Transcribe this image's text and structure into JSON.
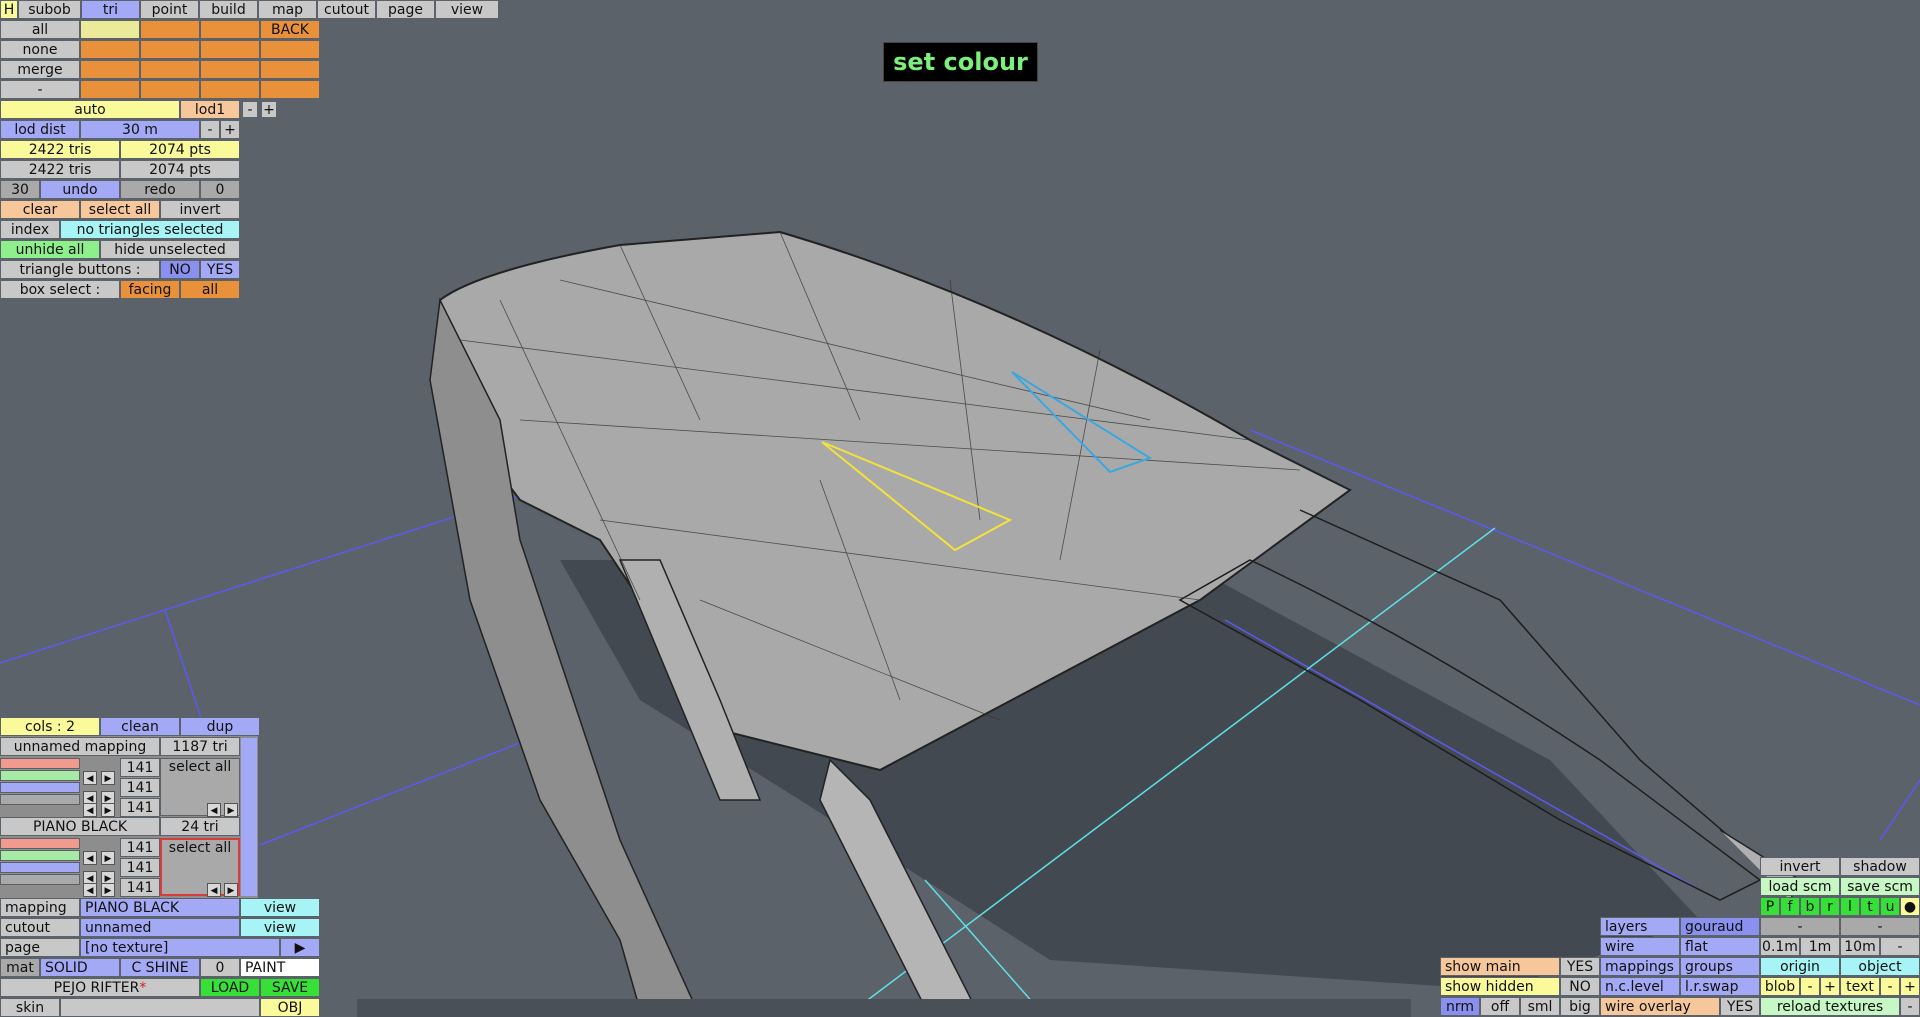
{
  "top_menu": {
    "h": "H",
    "items": [
      "subob",
      "tri",
      "point",
      "build",
      "map",
      "cutout",
      "page",
      "view"
    ]
  },
  "select_grid": {
    "rows": [
      "all",
      "none",
      "merge",
      "-"
    ],
    "back": "BACK"
  },
  "lod": {
    "auto": "auto",
    "lod1": "lod1",
    "minus": "-",
    "plus": "+",
    "dist_label": "lod dist",
    "dist_value": "30 m"
  },
  "stats": {
    "tris1": "2422 tris",
    "pts1": "2074 pts",
    "tris2": "2422 tris",
    "pts2": "2074 pts"
  },
  "undo_row": {
    "count": "30",
    "undo": "undo",
    "redo": "redo",
    "redo_count": "0"
  },
  "select_row": {
    "clear": "clear",
    "select_all": "select all",
    "invert": "invert"
  },
  "index_row": {
    "index": "index",
    "status": "no triangles selected"
  },
  "hide_row": {
    "unhide": "unhide all",
    "hide": "hide unselected"
  },
  "tri_buttons": {
    "label": "triangle buttons :",
    "no": "NO",
    "yes": "YES"
  },
  "box_select": {
    "label": "box select :",
    "facing": "facing",
    "all": "all"
  },
  "set_colour": "set colour",
  "mapping_panel": {
    "cols": "cols : 2",
    "clean": "clean",
    "dup": "dup",
    "groups": [
      {
        "name": "unnamed mapping",
        "count": "1187 tri",
        "values": [
          "141",
          "141",
          "141"
        ],
        "select_all": "select all"
      },
      {
        "name": "PIANO BLACK",
        "count": "24 tri",
        "values": [
          "141",
          "141",
          "141"
        ],
        "select_all": "select all"
      }
    ],
    "swatch_colors": [
      "#f29a8c",
      "#a7eaa3",
      "#a4a9f5",
      "#a9a9a9"
    ]
  },
  "bottom_left": {
    "mapping_label": "mapping",
    "mapping_value": "PIANO BLACK",
    "mapping_view": "view",
    "cutout_label": "cutout",
    "cutout_value": "unnamed",
    "cutout_view": "view",
    "page_label": "page",
    "page_value": "[no texture]",
    "page_arrow": "▶",
    "mat_label": "mat",
    "mat_solid": "SOLID",
    "mat_shine": "C SHINE",
    "mat_num": "0",
    "mat_paint": "PAINT",
    "file_name": "PEJO RIFTER",
    "file_mark": "*",
    "load": "LOAD",
    "save": "SAVE",
    "skin": "skin",
    "obj": "OBJ"
  },
  "bottom_right": {
    "invert": "invert",
    "shadow": "shadow",
    "load_scm": "load scm",
    "save_scm": "save scm",
    "letters": [
      "P",
      "f",
      "b",
      "r",
      "l",
      "t",
      "u"
    ],
    "dash1": "-",
    "dash2": "-",
    "layers": "layers",
    "gouraud": "gouraud",
    "wire": "wire",
    "flat": "flat",
    "d01": "0.1m",
    "d1": "1m",
    "d10": "10m",
    "dminus": "-",
    "mappings": "mappings",
    "groups": "groups",
    "origin": "origin",
    "object": "object",
    "ncl": "n.c.level",
    "lrswap": "l.r.swap",
    "blob": "blob",
    "bminus": "-",
    "bplus": "+",
    "text": "text",
    "tminus": "-",
    "tplus": "+",
    "show_main": "show main",
    "show_main_v": "YES",
    "show_hidden": "show hidden",
    "show_hidden_v": "NO",
    "nrm": "nrm",
    "off": "off",
    "sml": "sml",
    "big": "big",
    "wire_overlay": "wire overlay",
    "wire_overlay_v": "YES",
    "reload": "reload textures",
    "rminus": "-"
  },
  "colors": {
    "background": "#5b626a",
    "mesh": "#a8a8a8",
    "accent_green": "#7cf07a",
    "selected_tri": "#f4e23a",
    "cyan_tri": "#3aa7e0"
  }
}
